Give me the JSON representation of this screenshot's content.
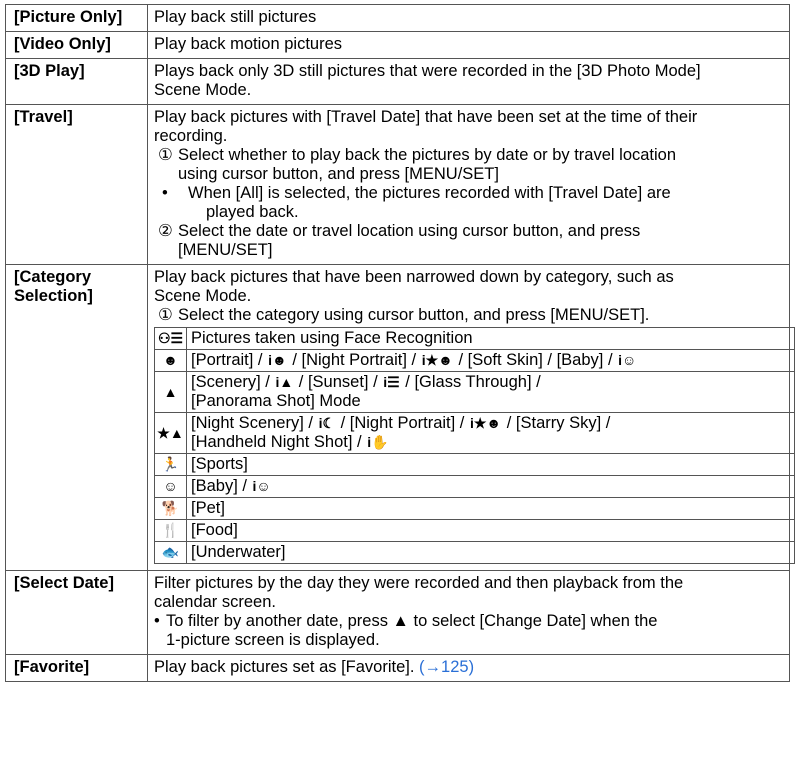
{
  "rows": [
    {
      "label": "[Picture Only]",
      "text": "Play back still pictures"
    },
    {
      "label": "[Video Only]",
      "text": "Play back motion pictures"
    },
    {
      "label": "[3D Play]",
      "line1": "Plays back only 3D still pictures that were recorded in the [3D Photo Mode]",
      "line2": "Scene Mode."
    },
    {
      "label": "[Travel]",
      "line1": "Play back pictures with [Travel Date] that have been set at the time of their",
      "line2": "recording.",
      "step1_num": "①",
      "step1_a": "Select whether to play back the pictures by date or by travel location",
      "step1_b": "using cursor button, and press [MENU/SET]",
      "bullet_a": "When [All] is selected, the pictures recorded with [Travel Date] are",
      "bullet_b": "played back.",
      "step2_num": "②",
      "step2_a": "Select the date or travel location using cursor button, and press",
      "step2_b": "[MENU/SET]"
    },
    {
      "label_a": "[Category",
      "label_b": "Selection]",
      "line1": "Play back pictures that have been narrowed down by category, such as",
      "line2": "Scene Mode.",
      "step1_num": "①",
      "step1": "Select the category using cursor button, and press [MENU/SET]."
    },
    {
      "label": "[Select Date]",
      "line1": "Filter pictures by the day they were recorded and then playback from the",
      "line2": "calendar screen.",
      "bullet_a": "To filter by another date, press",
      "arrow": "▲",
      "bullet_b": "to select [Change Date] when the",
      "bullet_c": "1-picture screen is displayed."
    },
    {
      "label": "[Favorite]",
      "text": "Play back pictures set as [Favorite].",
      "link": "(→125)"
    }
  ],
  "categories": [
    {
      "icon": "face-recognition-icon",
      "glyph": "⚇☰",
      "text": "Pictures taken using Face Recognition"
    },
    {
      "icon": "portrait-icon",
      "glyph": "☻",
      "parts": [
        "[Portrait] / ",
        "i☻",
        " / [Night Portrait] / ",
        "i★☻",
        " / [Soft Skin] / [Baby] / ",
        "i☺"
      ]
    },
    {
      "icon": "scenery-icon",
      "glyph": "▲",
      "parts_a": [
        "[Scenery] / ",
        "i▲",
        " / [Sunset] / ",
        "i☰",
        " / [Glass Through] /"
      ],
      "line_b": "[Panorama Shot] Mode"
    },
    {
      "icon": "night-scenery-icon",
      "glyph": "★▲",
      "parts_a": [
        "[Night Scenery] / ",
        "i☾",
        " / [Night Portrait] / ",
        "i★☻",
        " / [Starry Sky] /"
      ],
      "parts_b": [
        "[Handheld Night Shot] / ",
        "i✋"
      ]
    },
    {
      "icon": "sports-icon",
      "glyph": "🏃",
      "text": "[Sports]"
    },
    {
      "icon": "baby-icon",
      "glyph": "☺",
      "text": "[Baby] / ",
      "extra": "i☺"
    },
    {
      "icon": "pet-icon",
      "glyph": "🐕",
      "text": "[Pet]"
    },
    {
      "icon": "food-icon",
      "glyph": "🍴",
      "text": "[Food]"
    },
    {
      "icon": "underwater-icon",
      "glyph": "🐟",
      "text": "[Underwater]"
    }
  ]
}
